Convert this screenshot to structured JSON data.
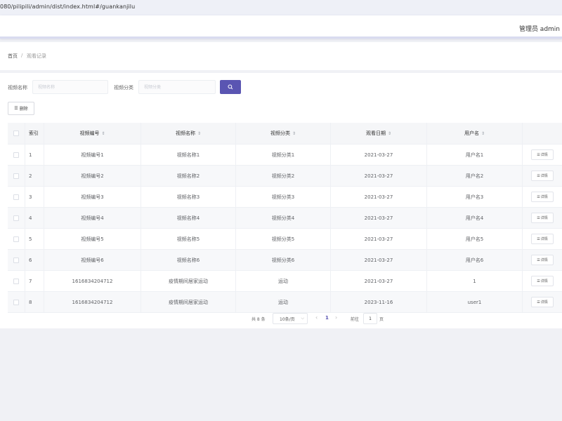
{
  "browser": {
    "url": "080/pilipili/admin/dist/index.html#/guankanjilu"
  },
  "header": {
    "user": "管理员 admin"
  },
  "breadcrumb": {
    "home": "首页",
    "separator": "/",
    "current": "观看记录"
  },
  "search": {
    "field1_label": "视频名称",
    "field1_placeholder": "视频名称",
    "field2_label": "视频分类",
    "field2_placeholder": "视频分类"
  },
  "toolbar": {
    "delete_label": "删除",
    "delete_icon": "list-icon"
  },
  "table": {
    "columns": [
      "索引",
      "视频编号",
      "视频名称",
      "视频分类",
      "观看日期",
      "用户名"
    ],
    "sort_glyph": "⇕",
    "detail_label": "详情",
    "rows": [
      [
        "1",
        "视频编号1",
        "视频名称1",
        "视频分类1",
        "2021-03-27",
        "用户名1"
      ],
      [
        "2",
        "视频编号2",
        "视频名称2",
        "视频分类2",
        "2021-03-27",
        "用户名2"
      ],
      [
        "3",
        "视频编号3",
        "视频名称3",
        "视频分类3",
        "2021-03-27",
        "用户名3"
      ],
      [
        "4",
        "视频编号4",
        "视频名称4",
        "视频分类4",
        "2021-03-27",
        "用户名4"
      ],
      [
        "5",
        "视频编号5",
        "视频名称5",
        "视频分类5",
        "2021-03-27",
        "用户名5"
      ],
      [
        "6",
        "视频编号6",
        "视频名称6",
        "视频分类6",
        "2021-03-27",
        "用户名6"
      ],
      [
        "7",
        "1616834204712",
        "疫情期间居家运动",
        "运动",
        "2021-03-27",
        "1"
      ],
      [
        "8",
        "1616834204712",
        "疫情期间居家运动",
        "运动",
        "2023-11-16",
        "user1"
      ]
    ]
  },
  "pagination": {
    "total": "共 8 条",
    "page_size": "10条/页",
    "current_page": "1",
    "goto_label": "前往",
    "goto_value": "1",
    "goto_unit": "页"
  },
  "colors": {
    "accent": "#5a55b2",
    "background": "#f0f1f5"
  }
}
